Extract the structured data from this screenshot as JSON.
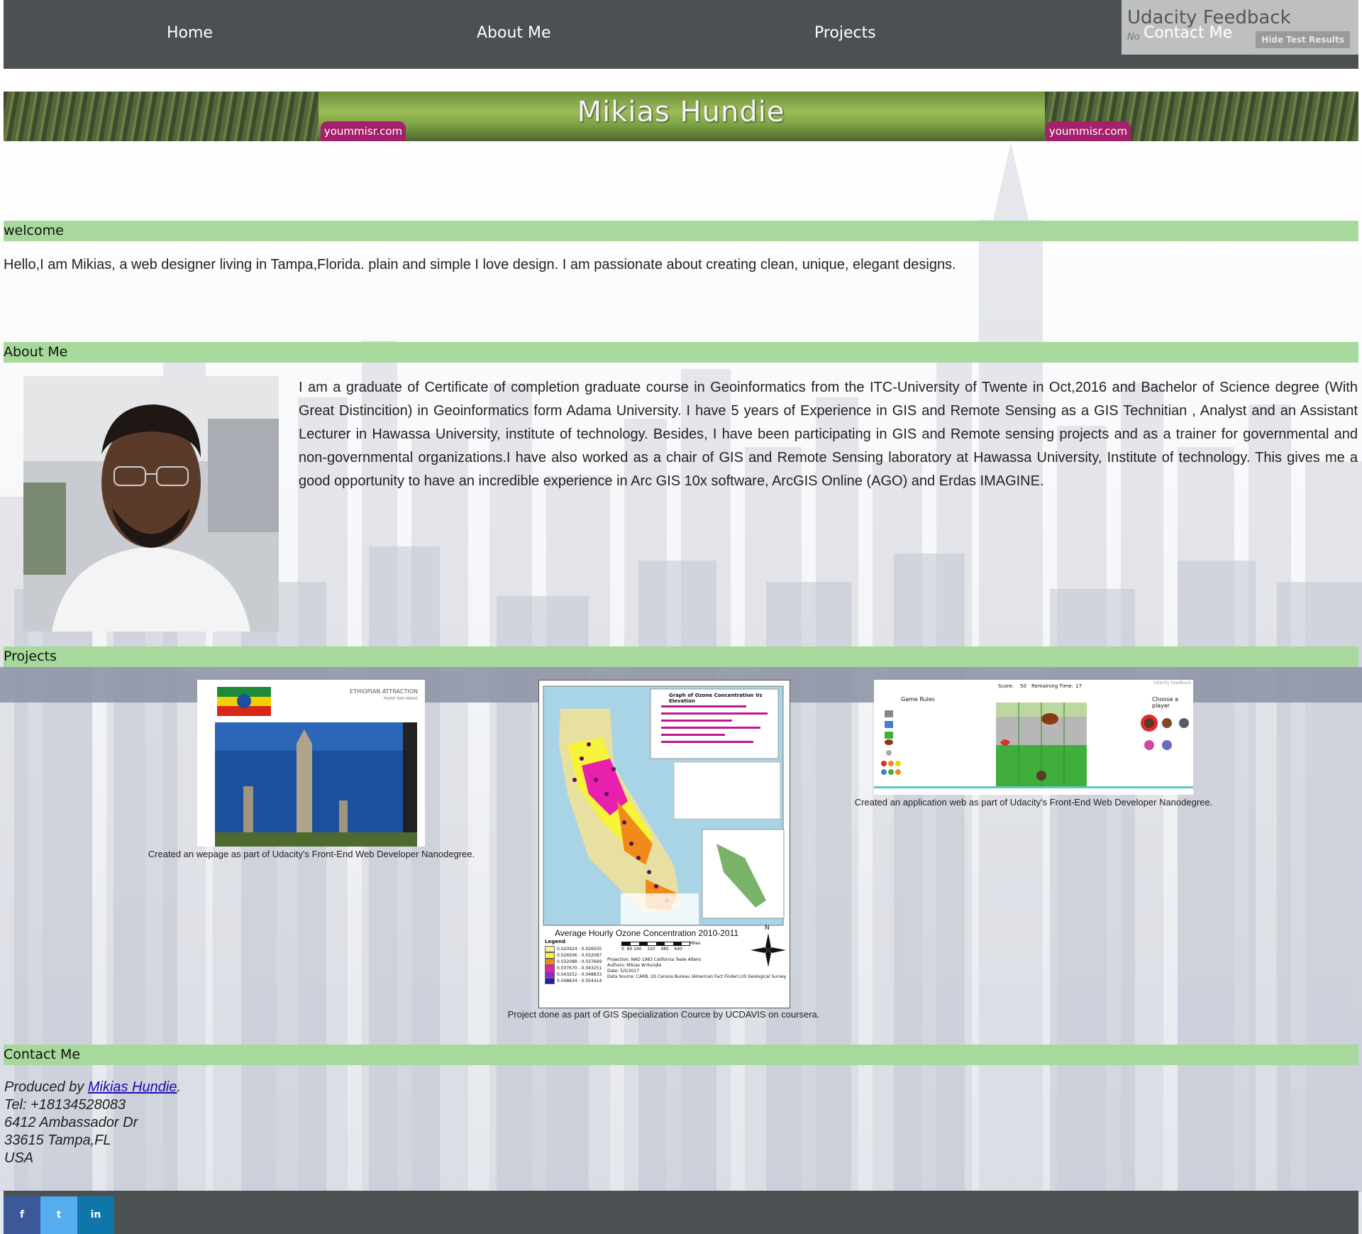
{
  "nav": {
    "home": "Home",
    "about": "About Me",
    "projects": "Projects",
    "contact": "Contact Me"
  },
  "feedback": {
    "title": "Udacity Feedback",
    "subtitle": "No",
    "hide_button": "Hide Test Results"
  },
  "banner": {
    "title": "Mikias Hundie",
    "watermark": "yoummisr.com"
  },
  "sections": {
    "welcome": "welcome",
    "about": "About Me",
    "projects": "Projects",
    "contact": "Contact Me"
  },
  "welcome_text": "Hello,I am Mikias, a web designer living in Tampa,Florida. plain and simple I love design. I am passionate about creating clean, unique, elegant designs.",
  "about_text": "I am a graduate of Certificate of completion graduate course in Geoinformatics from the ITC-University of Twente in Oct,2016 and Bachelor of Science degree (With Great Distincition) in Geoinformatics form Adama University. I have 5 years of Experience in GIS and Remote Sensing as a GIS Technitian , Analyst and an Assistant Lecturer in Hawassa University, institute of technology. Besides, I have been participating in GIS and Remote sensing projects and as a trainer for governmental and non-governmental organizations.I have also worked as a chair of GIS and Remote Sensing laboratory at Hawassa University, Institute of technology. This gives me a good opportunity to have an incredible experience in Arc GIS 10x software, ArcGIS Online (AGO) and Erdas IMAGINE.",
  "projects": [
    {
      "caption": "Created an wepage as part of Udacity's Front-End Web Developer Nanodegree.",
      "thumb_header": "ETHIOPIAN ATTRACTION",
      "thumb_sub": "FRONT END MIKIAS"
    },
    {
      "caption": "Project done as part of GIS Specialization Cource by UCDAVIS on coursera.",
      "map_title": "Average Hourly Ozone Concentration 2010-2011",
      "chart_title": "Graph of Ozone Concentration Vs Elevation",
      "legend_title": "Legend",
      "legend_items": [
        "0.020924 - 0.026505",
        "0.026506 - 0.032087",
        "0.032088 - 0.037669",
        "0.037670 - 0.043251",
        "0.043252 - 0.048833",
        "0.048834 - 0.054414"
      ],
      "legend_colors": [
        "#f4f0a0",
        "#f7f23a",
        "#f08b1a",
        "#e91fae",
        "#9b23c9",
        "#1e1ea8"
      ],
      "scale_label": "Miles",
      "scale_ticks": "0  80 160    320    480    640",
      "projection": "Projection: NAD 1983 California Teale Albers",
      "authors": "Authors: Mikias W.Hundie",
      "date": "Date: 5/5/2017",
      "source": "Data Source: CARB, US Census Bureau (American Fact Finder),US Geological Survey",
      "north": "N"
    },
    {
      "caption": "Created an application web as part of Udacity's Front-End Web Developer Nanodegree.",
      "score_label": "Score:",
      "score": "50",
      "time_label": "Remaining Time:",
      "time": "17",
      "rules_title": "Game Rules",
      "choose_title": "Choose a player",
      "mini_feedback": "Udacity Feedback"
    }
  ],
  "contact": {
    "produced_prefix": "Produced by ",
    "name": "Mikias Hundie",
    "suffix": ".",
    "tel": "Tel: +18134528083",
    "address1": "6412 Ambassador Dr",
    "address2": "33615 Tampa,FL",
    "country": "USA"
  },
  "social": {
    "facebook": "f",
    "twitter": "t",
    "linkedin": "in"
  },
  "colors": {
    "nav_bg": "#4b5153",
    "section_bar": "#a6d99b",
    "banner_tag": "#a3206a",
    "facebook": "#3b5998",
    "twitter": "#55acee",
    "linkedin": "#0e76a8"
  }
}
